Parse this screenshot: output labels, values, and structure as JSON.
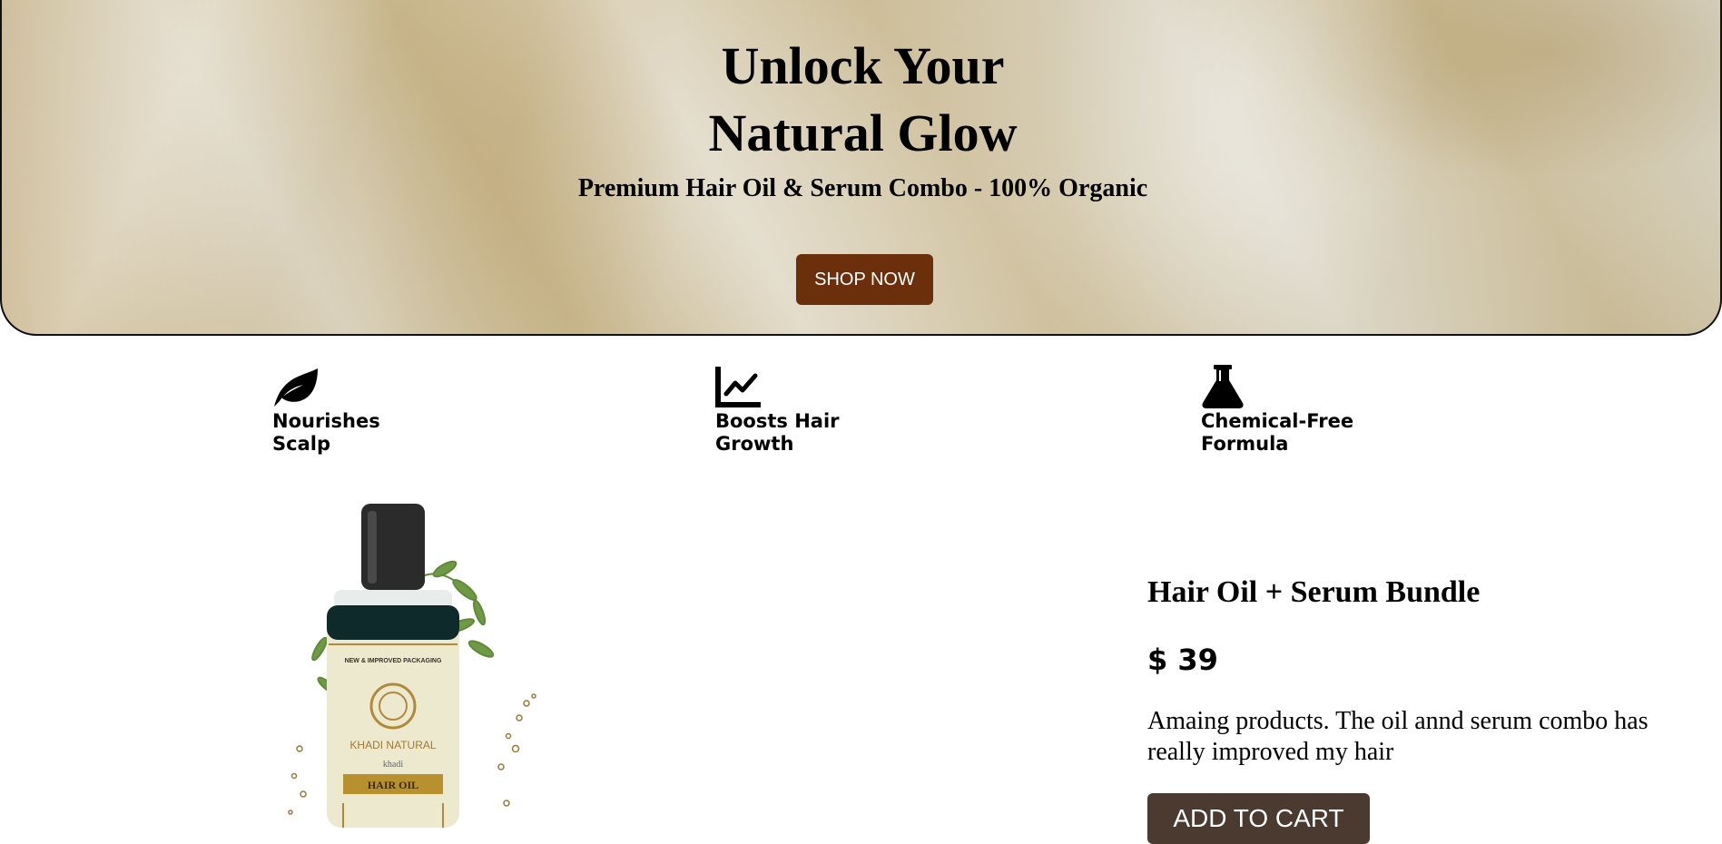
{
  "hero": {
    "title_line1": "Unlock Your",
    "title_line2": "Natural Glow",
    "subtitle": "Premium Hair Oil & Serum Combo - 100% Organic",
    "cta_label": "SHOP NOW",
    "cta_color": "#6b2f0c"
  },
  "features": [
    {
      "icon": "leaf-icon",
      "line1": "Nourishes",
      "line2": "Scalp"
    },
    {
      "icon": "chart-line-icon",
      "line1": "Boosts Hair",
      "line2": "Growth"
    },
    {
      "icon": "flask-icon",
      "line1": "Chemical-Free",
      "line2": "Formula"
    }
  ],
  "product": {
    "image_brand_text": "KHADI NATURAL",
    "image_small_text": "khadi",
    "image_label": "HAIR OIL",
    "image_top_text": "NEW & IMPROVED PACKAGING",
    "title": "Hair Oil + Serum Bundle",
    "price": "$ 39",
    "description": "Amaing products. The oil annd serum combo has really improved my hair",
    "cart_label": "ADD TO CART",
    "cart_color": "#4a3a30"
  }
}
